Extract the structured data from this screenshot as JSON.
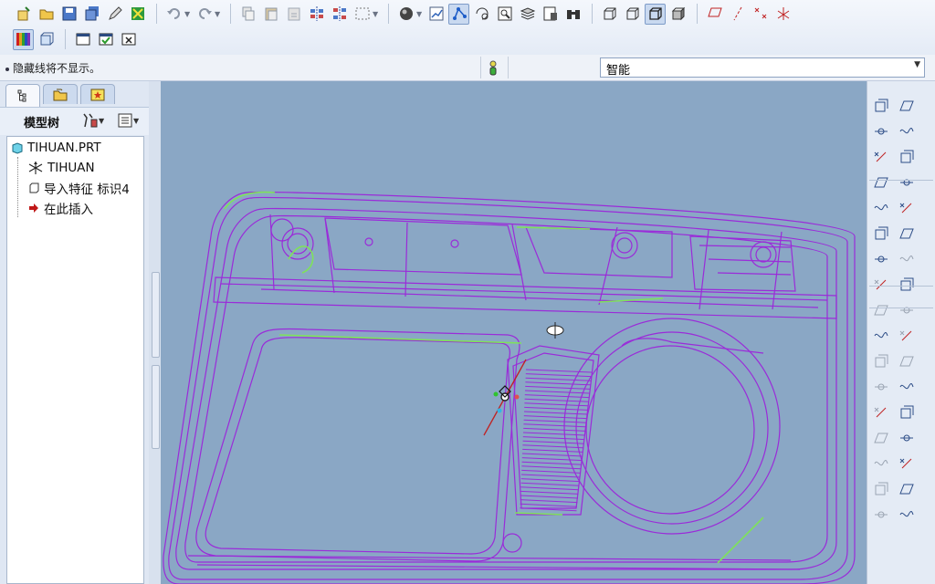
{
  "toolbar": {
    "row1": [
      {
        "name": "new-file-icon"
      },
      {
        "name": "open-file-icon"
      },
      {
        "name": "save-icon"
      },
      {
        "name": "save-copy-icon"
      },
      {
        "name": "edit-icon"
      },
      {
        "name": "regenerate-icon"
      },
      {
        "name": "undo-icon"
      },
      {
        "name": "redo-icon"
      },
      {
        "name": "copy-icon"
      },
      {
        "name": "paste-icon"
      },
      {
        "name": "paste-special-icon"
      },
      {
        "name": "mirror-icon"
      },
      {
        "name": "pattern-icon"
      },
      {
        "name": "select-box-icon"
      },
      {
        "name": "display-style-icon"
      },
      {
        "name": "model-tree-toggle-icon"
      },
      {
        "name": "datum-display-icon"
      },
      {
        "name": "orient-icon"
      },
      {
        "name": "zoom-window-icon"
      },
      {
        "name": "layers-icon"
      },
      {
        "name": "saved-views-icon"
      },
      {
        "name": "binoculars-icon"
      },
      {
        "name": "wireframe-icon"
      },
      {
        "name": "hidden-line-icon"
      },
      {
        "name": "no-hidden-icon"
      },
      {
        "name": "shading-icon"
      },
      {
        "name": "datum-plane-display-icon"
      },
      {
        "name": "datum-axis-display-icon"
      },
      {
        "name": "datum-point-display-icon"
      },
      {
        "name": "csys-display-icon"
      }
    ],
    "row2": [
      {
        "name": "appearance-gallery-icon"
      },
      {
        "name": "appearance-editor-icon"
      },
      {
        "name": "window-new-icon"
      },
      {
        "name": "window-activate-icon"
      },
      {
        "name": "window-close-icon"
      }
    ]
  },
  "status": {
    "message": "隐藏线将不显示。",
    "filter_value": "智能"
  },
  "model_tree": {
    "title": "模型树",
    "nodes": [
      {
        "label": "TIHUAN.PRT",
        "icon": "part-icon"
      },
      {
        "label": "TIHUAN",
        "icon": "csys-icon"
      },
      {
        "label": "导入特征 标识4",
        "icon": "import-feature-icon"
      },
      {
        "label": "在此插入",
        "icon": "insert-here-arrow-icon"
      }
    ]
  },
  "right_toolbar": [
    "datum-plane-icon",
    "datum-plane-offset-icon",
    "datum-axis-icon",
    "datum-curve-sketch-icon",
    "datum-point-icon",
    "datum-plane-tangent-icon",
    "datum-csys-icon",
    "datum-axis-line-icon",
    "surface-blend-icon",
    "curve-icon",
    "sketch-icon",
    "point-offset-icon",
    "fill-icon",
    "point-field-icon",
    "mirror-feature-icon",
    "analysis-icon",
    "round-icon",
    "dimension-icon",
    "draft-icon",
    "shell-icon",
    "fold-icon",
    "rib-icon",
    "curve-spline-icon",
    "hole-icon",
    "extrude-icon",
    "revolve-icon",
    "sweep-icon",
    "blend-icon",
    "boundary-icon",
    "sweep-blend-icon",
    "warp-icon",
    "trim-icon",
    "offset-icon",
    "merge-icon"
  ],
  "colors": {
    "viewport_bg": "#8aa7c5",
    "model_edge": "#9a2bd9",
    "highlight_edge": "#7fe25a",
    "axis_red": "#c02222"
  }
}
